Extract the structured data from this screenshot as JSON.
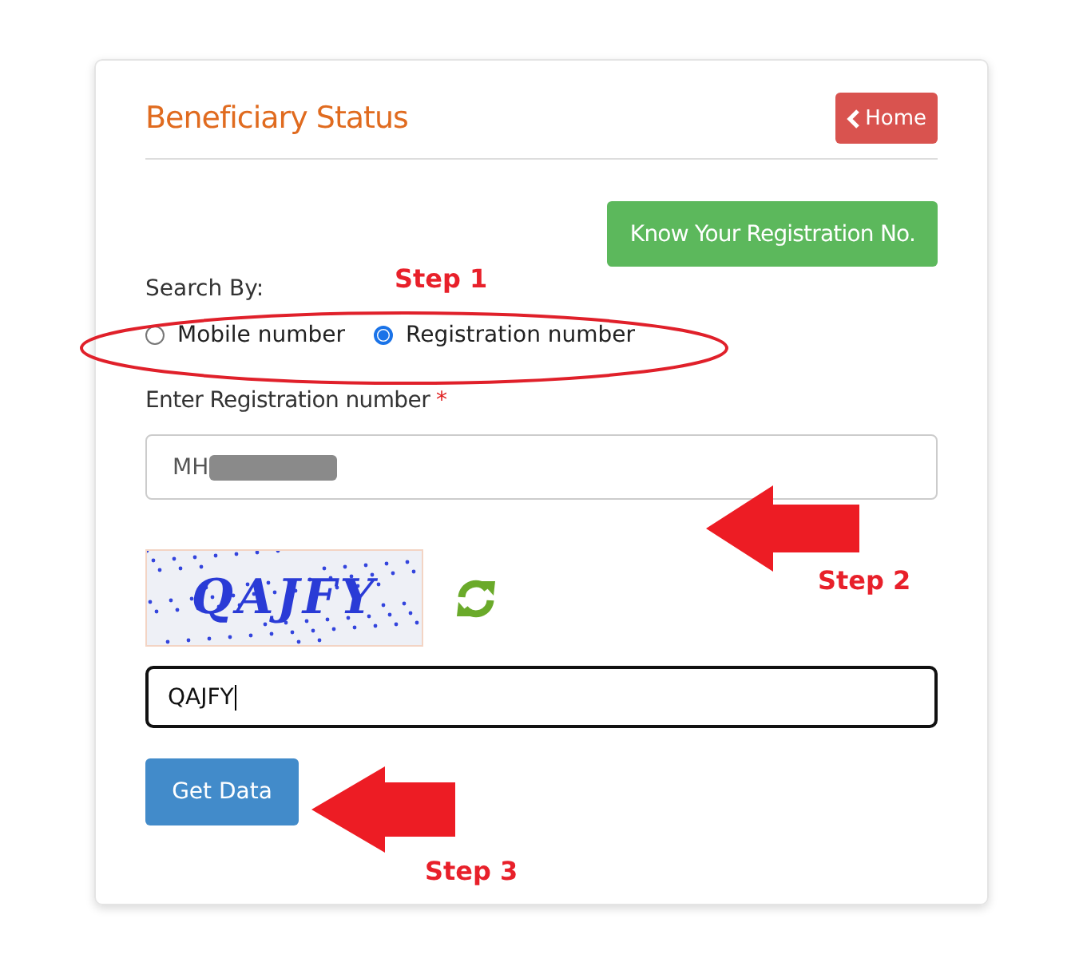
{
  "form": {
    "title": "Beneficiary Status",
    "home_button": "Home",
    "know_button": "Know Your Registration No.",
    "search_by": {
      "label": "Search By:",
      "options": [
        {
          "label": "Mobile number",
          "selected": false
        },
        {
          "label": "Registration number",
          "selected": true
        }
      ]
    },
    "registration_field": {
      "label": "Enter Registration number",
      "required": "*",
      "value": "MH",
      "redacted": true
    },
    "captcha": {
      "text": "QAJFY"
    },
    "captcha_field": {
      "value": "QAJFY",
      "focused": true
    },
    "submit_button": "Get Data"
  },
  "annotations": [
    {
      "kind": "ellipse",
      "label": "Step 1"
    },
    {
      "kind": "arrow",
      "label": "Step 2"
    },
    {
      "kind": "arrow",
      "label": "Step 3"
    }
  ]
}
